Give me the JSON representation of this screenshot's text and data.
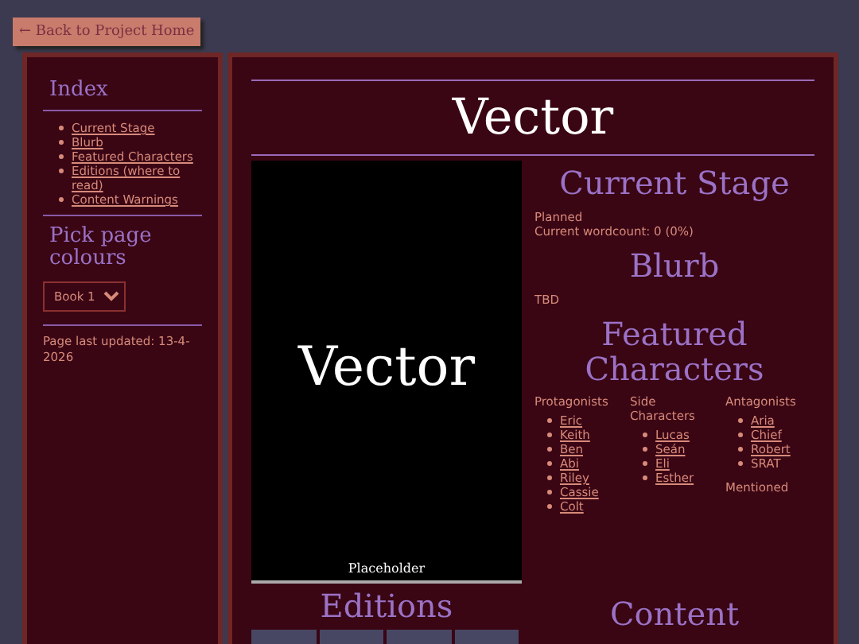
{
  "back_link": "← Back to Project Home",
  "sidebar": {
    "index_title": "Index",
    "index_items": [
      "Current Stage",
      "Blurb",
      "Featured Characters",
      "Editions (where to read)",
      "Content Warnings"
    ],
    "colours_title": "Pick page colours",
    "colour_select": {
      "value": "Book 1"
    },
    "last_updated": "Page last updated: 13-4-2026"
  },
  "title": "Vector",
  "cover": {
    "title": "Vector",
    "caption": "Placeholder"
  },
  "editions": {
    "heading": "Editions"
  },
  "current_stage": {
    "heading": "Current Stage",
    "stage": "Planned",
    "wordcount": "Current wordcount: 0 (0%)"
  },
  "blurb": {
    "heading": "Blurb",
    "text": "TBD"
  },
  "characters": {
    "heading": "Featured Characters",
    "groups": [
      {
        "title": "Protagonists",
        "names": [
          {
            "name": "Eric",
            "link": true
          },
          {
            "name": "Keith",
            "link": true
          },
          {
            "name": "Ben",
            "link": true
          },
          {
            "name": "Abi",
            "link": true
          },
          {
            "name": "Riley",
            "link": true
          },
          {
            "name": "Cassie",
            "link": true
          },
          {
            "name": "Colt",
            "link": true
          }
        ]
      },
      {
        "title": "Side Characters",
        "names": [
          {
            "name": "Lucas",
            "link": true
          },
          {
            "name": "Seán",
            "link": true
          },
          {
            "name": "Eli",
            "link": true
          },
          {
            "name": "Esther",
            "link": true
          }
        ]
      },
      {
        "title": "Antagonists",
        "names": [
          {
            "name": "Aria",
            "link": true
          },
          {
            "name": "Chief",
            "link": true
          },
          {
            "name": "Robert",
            "link": true
          },
          {
            "name": "SRAT",
            "link": false
          }
        ],
        "subtitle": "Mentioned"
      }
    ]
  },
  "content_warnings": {
    "heading": "Content"
  }
}
